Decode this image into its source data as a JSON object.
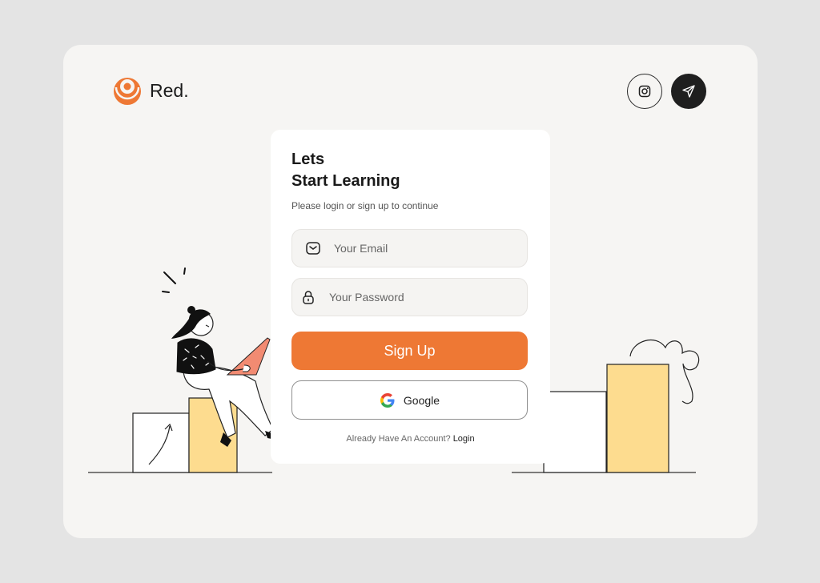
{
  "brand": {
    "name": "Red.",
    "accent": "#ee7834"
  },
  "social": {
    "instagram_icon": "instagram-icon",
    "send_icon": "paper-plane-icon"
  },
  "card": {
    "title_line1": "Lets",
    "title_line2": "Start Learning",
    "subtitle": "Please login or sign up to continue",
    "email_placeholder": "Your Email",
    "password_placeholder": "Your Password",
    "signup_label": "Sign Up",
    "google_label": "Google",
    "footer_text": "Already Have An Account?",
    "login_link": "Login"
  }
}
